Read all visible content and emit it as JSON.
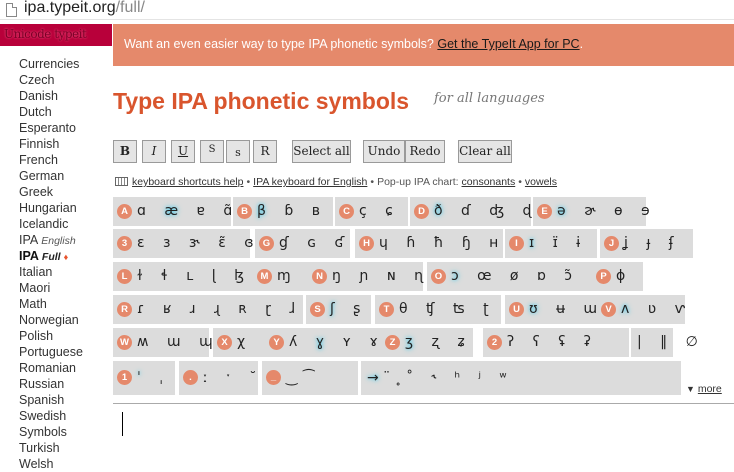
{
  "browser": {
    "url_host": "ipa.typeit.org",
    "url_path": "/full/"
  },
  "sidebar": {
    "logo_text": "Unicode typeit",
    "items": [
      {
        "label": "Currencies"
      },
      {
        "label": "Czech"
      },
      {
        "label": "Danish"
      },
      {
        "label": "Dutch"
      },
      {
        "label": "Esperanto"
      },
      {
        "label": "Finnish"
      },
      {
        "label": "French"
      },
      {
        "label": "German"
      },
      {
        "label": "Greek"
      },
      {
        "label": "Hungarian"
      },
      {
        "label": "Icelandic"
      },
      {
        "label": "IPA",
        "sub": "English"
      },
      {
        "label": "IPA",
        "sub": "Full",
        "marker": "♦",
        "active": true
      },
      {
        "label": "Italian"
      },
      {
        "label": "Maori"
      },
      {
        "label": "Math"
      },
      {
        "label": "Norwegian"
      },
      {
        "label": "Polish"
      },
      {
        "label": "Portuguese"
      },
      {
        "label": "Romanian"
      },
      {
        "label": "Russian"
      },
      {
        "label": "Spanish"
      },
      {
        "label": "Swedish"
      },
      {
        "label": "Symbols"
      },
      {
        "label": "Turkish"
      },
      {
        "label": "Welsh"
      }
    ]
  },
  "promo": {
    "text": "Want an even easier way to type IPA phonetic symbols?",
    "link": "Get the TypeIt App for PC",
    "suffix": "."
  },
  "heading": {
    "title": "Type IPA phonetic symbols",
    "subtitle": "for all languages"
  },
  "toolbar": {
    "format_buttons": [
      "B",
      "I",
      "U",
      "S",
      "s",
      "R"
    ],
    "select_all": "Select all",
    "undo": "Undo",
    "redo": "Redo",
    "clear_all": "Clear all"
  },
  "links": {
    "shortcuts": "keyboard shortcuts help",
    "ipa_keyboard": "IPA keyboard for English",
    "popup_label": "Pop-up IPA chart:",
    "consonants": "consonants",
    "vowels": "vowels",
    "separator": "•"
  },
  "keyboard": {
    "rows": [
      [
        {
          "key": "A",
          "symbols": "ɑ æ ɐ ɑ̃",
          "glow": "æ"
        },
        {
          "key": "B",
          "symbols": "β ɓ ʙ",
          "glow": "β"
        },
        {
          "key": "C",
          "symbols": "ç ɕ"
        },
        {
          "key": "D",
          "symbols": "ð ɗ ʤ ɖ ɗ",
          "glow": "ð"
        },
        {
          "key": "E",
          "symbols": "ə ɚ ɵ ɘ",
          "glow": "ə"
        }
      ],
      [
        {
          "key": "3",
          "symbols": "ɛ ɜ ɝ ɛ̃ ɞ"
        },
        {
          "key": "G",
          "symbols": "ɠ ɢ ʛ"
        },
        {
          "key": "H",
          "symbols": "ɥ ɦ ħ ɧ ʜ"
        },
        {
          "key": "I",
          "symbols": "ɪ ɪ̈ ɨ",
          "glow": "ɪ"
        },
        {
          "key": "J",
          "symbols": "ʝ ɟ ʄ"
        }
      ],
      [
        {
          "key": "L",
          "symbols": "ɫ ɬ ʟ ɭ ɮ"
        },
        {
          "key": "M",
          "symbols": "ɱ"
        },
        {
          "key": "N",
          "symbols": "ŋ ɲ ɴ ɳ"
        },
        {
          "key": "O",
          "symbols": "ɔ œ ø ɒ ɔ̃",
          "glow": "ɔ"
        },
        {
          "key": "P",
          "symbols": "ɸ"
        }
      ],
      [
        {
          "key": "R",
          "symbols": "ɾ ʁ ɹ ɻ ʀ ɽ ɺ"
        },
        {
          "key": "S",
          "symbols": "ʃ ʂ",
          "glow": "ʃ"
        },
        {
          "key": "T",
          "symbols": "θ ʧ ʦ ʈ"
        },
        {
          "key": "U",
          "symbols": "ʊ ʉ ɯ",
          "glow": "ʊ"
        },
        {
          "key": "V",
          "symbols": "ʌ ʋ ⱱ",
          "glow": "ʌ"
        }
      ],
      [
        {
          "key": "W",
          "symbols": "ʍ ɯ ɰ"
        },
        {
          "key": "X",
          "symbols": "χ"
        },
        {
          "key": "Y",
          "symbols": "ʎ ɣ ʏ ɤ",
          "glow": "ɣ"
        },
        {
          "key": "Z",
          "symbols": "ʒ ʐ ʑ",
          "glow": "ʒ"
        },
        {
          "key": "2",
          "symbols": "ʔ ʕ ʢ ʡ"
        },
        {
          "key": "",
          "symbols": "| ‖ ∅"
        }
      ],
      [
        {
          "key": "1",
          "symbols": "ˈ ˌ",
          "glow": "ˈ"
        },
        {
          "key": ".",
          "symbols": "ː ˑ ˘"
        },
        {
          "key": "_",
          "symbols": "‿ ͡"
        },
        {
          "key": "",
          "symbols": "→ ̈ ̥ ̊ ˞ ʰ ʲ ʷ",
          "glow": "→"
        }
      ]
    ],
    "more_label": "more"
  }
}
